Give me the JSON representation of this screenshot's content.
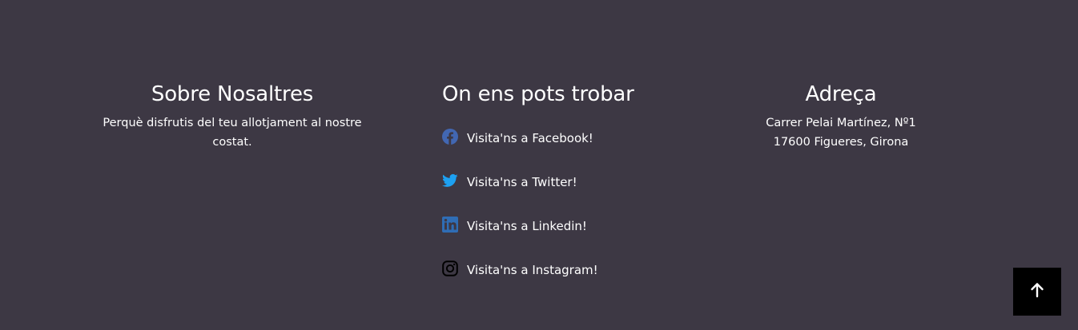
{
  "about": {
    "title": "Sobre Nosaltres",
    "text_line1": "Perquè disfrutis del teu allotjament al nostre",
    "text_line2": "costat."
  },
  "social": {
    "title": "On ens pots trobar",
    "items": [
      {
        "label": "Visita'ns a Facebook!",
        "icon": "facebook-icon",
        "color": "#4267b2"
      },
      {
        "label": "Visita'ns a Twitter!",
        "icon": "twitter-icon",
        "color": "#1da1f2"
      },
      {
        "label": "Visita'ns a Linkedin!",
        "icon": "linkedin-icon",
        "color": "#2f6db5"
      },
      {
        "label": "Visita'ns a Instagram!",
        "icon": "instagram-icon",
        "color": "#000000"
      }
    ]
  },
  "address": {
    "title": "Adreça",
    "line1": "Carrer Pelai Martínez, Nº1",
    "line2": "17600 Figueres, Girona"
  },
  "scroll_top": {
    "icon": "arrow-up-icon"
  },
  "colors": {
    "background": "#3d3844",
    "text": "#ffffff",
    "scroll_button": "#000000"
  }
}
